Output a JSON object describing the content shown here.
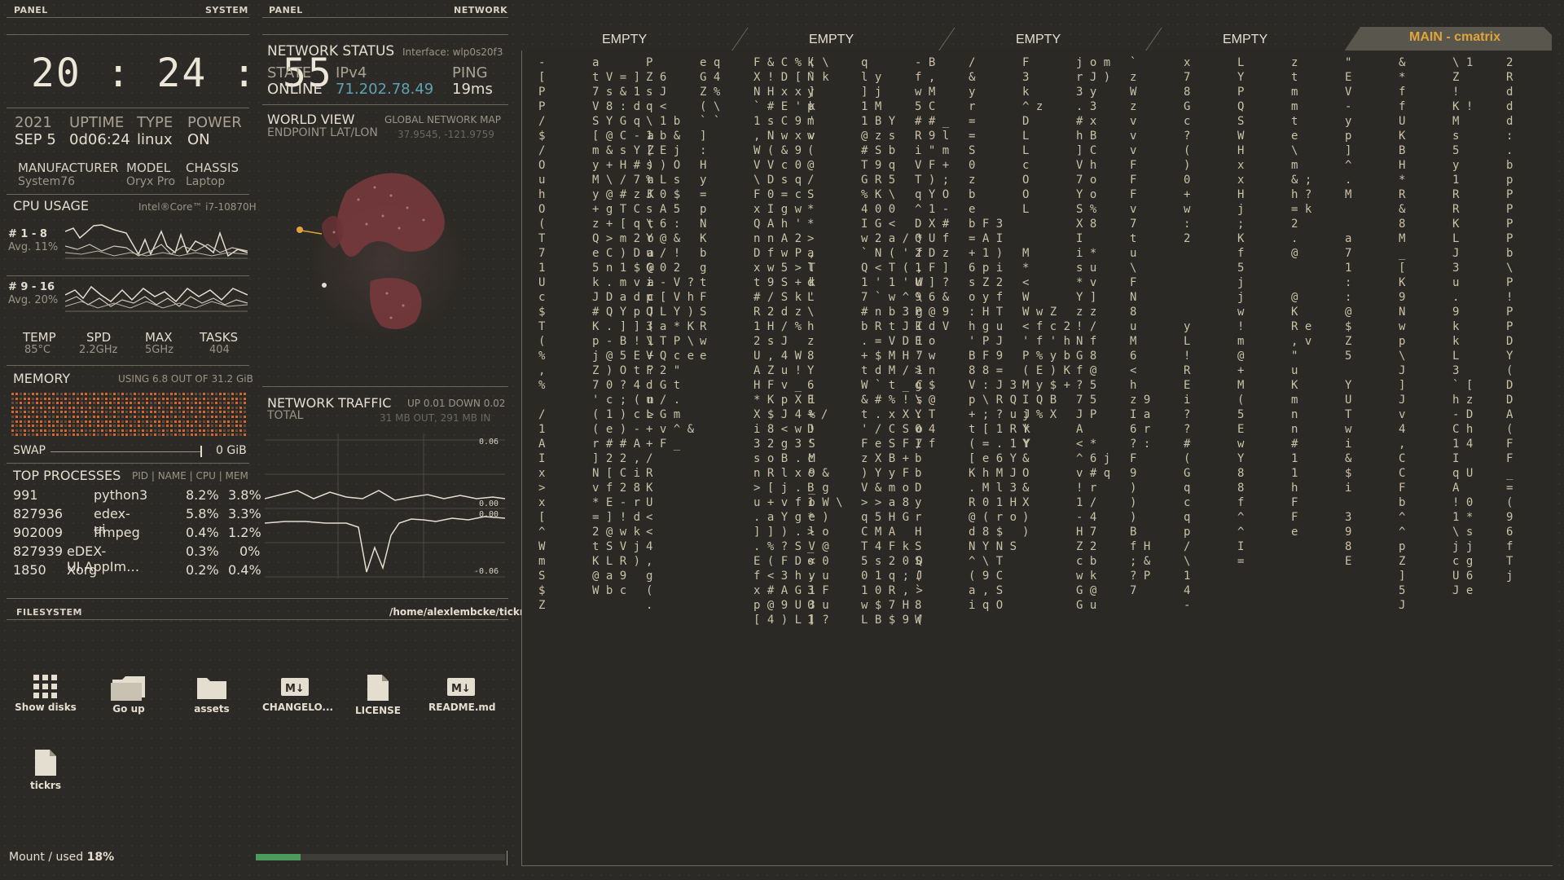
{
  "system_panel": {
    "left_header": "PANEL",
    "right_header": "SYSTEM",
    "clock": "20 : 24 : 55",
    "year": "2021",
    "date": "SEP 5",
    "uptime_label": "UPTIME",
    "uptime_value": "0d06:24",
    "type_label": "TYPE",
    "type_value": "linux",
    "power_label": "POWER",
    "power_value": "ON",
    "manufacturer_label": "MANUFACTURER",
    "manufacturer_value": "System76",
    "model_label": "MODEL",
    "model_value": "Oryx Pro",
    "chassis_label": "CHASSIS",
    "chassis_value": "Laptop",
    "cpu_usage_label": "CPU USAGE",
    "cpu_model": "Intel®Core™ i7-10870H",
    "cpu_group1_label": "# 1 - 8",
    "cpu_group1_avg": "Avg. 11%",
    "cpu_group2_label": "# 9 - 16",
    "cpu_group2_avg": "Avg. 20%",
    "temp_label": "TEMP",
    "temp_value": "85°C",
    "spd_label": "SPD",
    "spd_value": "2.2GHz",
    "max_label": "MAX",
    "max_value": "5GHz",
    "tasks_label": "TASKS",
    "tasks_value": "404",
    "memory_label": "MEMORY",
    "memory_usage": "USING 6.8 OUT OF 31.2 GiB",
    "swap_label": "SWAP",
    "swap_value": "0 GiB",
    "top_processes_label": "TOP PROCESSES",
    "top_processes_columns": "PID | NAME | CPU | MEM",
    "processes": [
      {
        "pid": "991",
        "name": "python3",
        "cpu": "8.2%",
        "mem": "3.8%"
      },
      {
        "pid": "827936",
        "name": "edex-ui",
        "cpu": "5.8%",
        "mem": "3.3%"
      },
      {
        "pid": "902009",
        "name": "ffmpeg",
        "cpu": "0.4%",
        "mem": "1.2%"
      },
      {
        "pid": "827939",
        "name": "eDEX-UI.AppIm…",
        "cpu": "0.3%",
        "mem": "0%"
      },
      {
        "pid": "1850",
        "name": "Xorg",
        "cpu": "0.2%",
        "mem": "0.4%"
      }
    ]
  },
  "network_panel": {
    "left_header": "PANEL",
    "right_header": "NETWORK",
    "status_label": "NETWORK STATUS",
    "interface": "Interface: wlp0s20f3",
    "state_label": "STATE",
    "state_value": "ONLINE",
    "ipv4_label": "IPv4",
    "ipv4_value": "71.202.78.49",
    "ping_label": "PING",
    "ping_value": "19ms",
    "world_view_label": "WORLD VIEW",
    "global_map_label": "GLOBAL NETWORK MAP",
    "endpoint_label": "ENDPOINT LAT/LON",
    "endpoint_value": "37.9545, -121.9759",
    "traffic_label": "NETWORK TRAFFIC",
    "traffic_updown": "UP 0.01 DOWN 0.02",
    "total_label": "TOTAL",
    "total_value": "31 MB OUT, 291 MB IN",
    "graph_top1": "0.06",
    "graph_mid1": "0.00",
    "graph_mid2": "0.00",
    "graph_bottom": "-0.06"
  },
  "filesystem": {
    "label": "FILESYSTEM",
    "path": "/home/alexlembcke/tickrs",
    "items": [
      {
        "icon": "grid-icon",
        "label": "Show disks"
      },
      {
        "icon": "folder-up-icon",
        "label": "Go up"
      },
      {
        "icon": "folder-icon",
        "label": "assets"
      },
      {
        "icon": "markdown-icon",
        "label": "CHANGELO..."
      },
      {
        "icon": "file-icon",
        "label": "LICENSE"
      },
      {
        "icon": "markdown-icon",
        "label": "README.md"
      },
      {
        "icon": "file-icon",
        "label": "tickrs"
      }
    ],
    "mount_label": "Mount / used",
    "mount_value": "18%",
    "mount_usage": 0.18
  },
  "terminal": {
    "tabs": [
      "EMPTY",
      "EMPTY",
      "EMPTY",
      "EMPTY"
    ],
    "active_tab": "MAIN - cmatrix",
    "matrix_columns": [
      "-\n[\nP\nP\n/\n$\n/\nO\nu\nh\nO\n(\nT\n7\n1\nU\nc\n$\nT\n(\n%\n,\n%\n\n/\n1\nA\nI\nx\n>\nx\n[\n^\nW\nm\nS\n$\nZ",
      "a\nt V = ]\n7 s & 1\nV 8 : d\nS Y G q\n[ @ C - a\nm & s Y Z\ny + H # )\nM \\ / 7 n\ny @ # z K\n+ g T C\nz + [ q t\nQ > m 2 o\ne C ) D a\n5 n 1 $ @\nk . m v a\nJ D a d c\n# Q Y p J\nK . ] ] (\np - B ! 1\nj @ 5 E +\nZ ) O t ?\n7 0 ? 4\n' c ; ( n\n( 1 ) c >\n( e ) -\nr # # A\n] 2 2 ,\nN [ C i\nv f 2 8\n* E - r\n= ] ! d\n2 @ w k\nt S V j\nK L R )\n@ a 9\nW b c",
      "P\nZ 6\ns J\nq <\n\\ 1 b\n1 b &\n[ E j\ns ) O\n% L s\nJ 0 $\ns A 5\n\\ 6 :\nY @ &\nu / !\nG 0 2\ni - V ?\np [ V h\nQ L Y )\n3 a * K\n\\ T P \\\nV Q c e\nF 2 \"\nd G t\nu / .\nL G m\n+ v ^ &\n+ F _\n/\nR\nK\nU\n<\n<\n4\n,\ng\n(\n.",
      "e q\nG 4\nZ %\n( \\\n` `\n]\n:\nH\ny\n=\np\nN\nK\nb\ng\nt\nF\nS\nR\nw\ne\n\n\n\n\n\n\n\n\n\n\n\n\n\n\n\n\n\n",
      "F & C % ( \\\nX ! D [ ` k\nN H x x ]\n` # E ' k\n1 s C 9 '\n, N w x v\nW ( & 9\nV V c 0\n\\ D s q\nF 0 = c\nx I g w\nQ A h '\nn n A 2\nD f w P ,\nx w 5 > T\nt 9 S + k\n# / S k '\nR 2 d z\n1 H / %\n2 s J\nU , 4 W\nA Z u !\nH F v _\n* K p X 1\nX $ J 4 %\ni 8 < w !\n3 2 g 3 S\ns o B . M\nn R l x 9 &\n> [ j . _ g\nu + v f o W \\\n. a Y g e )\n] ] ) . l o\n. % ? S V @\nE ( F D < 0\nf < 3 h y u\nx # A G 1 F\np @ 9 U 3 u\n[ 4 ) L ] ?",
      "k\nN\ny\np\nm\nw\n(\n@\n/\nS\n*\n*\n>\na\nl\nd\nL\n\\\nh\nz\n8\nY\n6\nE\n+ /\nD\n'\nc\nc\nB\n1\n*\n>\n_\no\n.\n3\n0\n1",
      "q\nl y\n] j\n1 M\n1 B Y\n@ z s\n# S b\nT 9 q\nG R 5\n% K \\\n4 0 0\nI G <\nw 2 a / *\n` N ( ' f\nQ < T ( ,\n1 ' 1 ' W\n7 ` w ^ \\\n# n b 3 g\nb R t J I\n. = V D 1\n+ $ M H 7\nt d M / 1\nW ` t _ C\n& # % ! s\nt . x X .\n' / C S o\nF e S F /\nz X B +\n) Y y F\nV & m o\n> > a 8\nq 5 H G\nC M A\nT 4 F k\n5 s 2 0 Q\n0 1 q ; J\n1 0 R , >\nw $ 7 H\nL B $ 9 (",
      "- B\nf ,\nw M\n5 C\n# # _\nR 9 l\ni \" m\nV F +\nT ) ;\nq Y O\n^ 1 -\nD X #\nQ U f\n2 D z\n1 F ]\nU ] ?\n9 6 &\nP @ 9\nk d V\nE o\n' w\n> n\ng $\n\\ @\nY T\n0 4\nI f\nb\nb\nD\ny\nr\nH\nS\nS\n(\n`\n8\nW",
      "/\n&\ny\nr\n=\n=\nS\n0\nz\nb\ne\nb F 3\n= A I\n+ 1 )\n6 p i\ns Z 2\no y f\n: H T\nh g u\n' P J\nB F 9\n8 8 =\nV : J 3\np \\ R Q\n+ ; ? u J\nt [ 1 R k\n( = . 1 Y\n[ e 6 Y\nK h M J\n. M l 3\nR 0 1 H\n@ ( r o\nd 8 $\nN Y N S\n^ \\ T\n( 9 C\na , S\ni q O",
      "F\n3\nk\n^ z\nD\nL\nL\nc\nO\nO\nL\n\n\nM\n*\n<\nW\nW w Z\n< f c 2\n' f ' h\nP % y b\n( E ) K\nM y $ +\nI Q B\nj % X\nY\nY\n&\nO\n&\nX\n)\n)\n\n\n\n\n",
      "j o m\nr J )\n3 y\n. 3\n# x\nh B\n] C\nV h\n7 o\nY o\nS %\nX 8\nI\ni *\ns u\n* v\nY ]\nz z\n! /\nN f\nG 8\nf @\n? 5\n7 5\nJ P\nA\n< *\n^ 6 j\nv # q\n! r\n1 /\n- 4\nH 7\nZ 2\nc b\nw k\nG @\nG u",
      "`\nz\nW\nz\nv\nv\nv\nF\nF\nF\nv\n7\nt\nu\n\\\nF\nN\n8\nu\nM\n6\n<\nh\nz 9\nI a\n6 r\n? :\nF\n9\n)\n)\n)\nB\nf H\n; &\n? P\n7",
      "x\n7\n8\nG\nc\n?\n(\n)\n0\n+\nw\n:\n2\n\n\n\n\n\ny\nL\n!\nR\nE\ni\n?\n?\n#\n(\nG\nq\nc\nq\np\n/\n\\\n1\n4\n-",
      "L\nY\nP\nQ\nS\nW\nH\nx\nx\nH\nj\n;\nK\nf\n5\nj\nj\nw\n!\nm\n@\n+\nM\n(\n5\nE\nw\nY\n8\n8\nf\n^\n^\nI\n=",
      "z\nt\nm\nm\nt\ne\n\\\nm\n& ;\nh ?\n= k\n2\n.\n@\n\n\n@\nK\nR e\n, v\n\"\nu\nK\nm\nn\nn\n#\n1\n1\nh\nF\nF\ne",
      "\"\nE\nV\n-\ny\np\n]\n^\n.\nM\n\n\na\n7\n1\n:\n:\n@\n$\nZ\n5\n\nY\nU\nT\nw\ni\n&\n$\ni\n\n3\n9\n8\nE",
      "&\n*\nf\nf\nU\nK\nB\nH\n*\nR\n&\n8\nM\n_\n[\nK\n9\nN\nw\np\n\\\nJ\n]\nJ\nv\n4\n,\nC\nC\nF\nb\n^\n^\np\nZ\n]\n5\nJ",
      "\\ 1\nZ\n!\nK !\nM\ns\n5\ny\n1\nR\nR\nK\nL\nJ\n3\nu\n.\n9\nk\nk\nL\n3\n` [\nh z\n- D\nC h\n1 4\nI\nq U\nA\n! 0\n1 *\n\\ s\nj j\nc g\nU 6\nJ e",
      "2\nR\nd\nd\nd\n:\n.\nb\np\nP\nP\nP\nP\nb\n\\\nP\n!\nP\nP\nD\nY\n(\nD\nD\nA\n(\nF\nF\n_\n=\n(\n9\n6\nf\nT\nj"
    ]
  }
}
